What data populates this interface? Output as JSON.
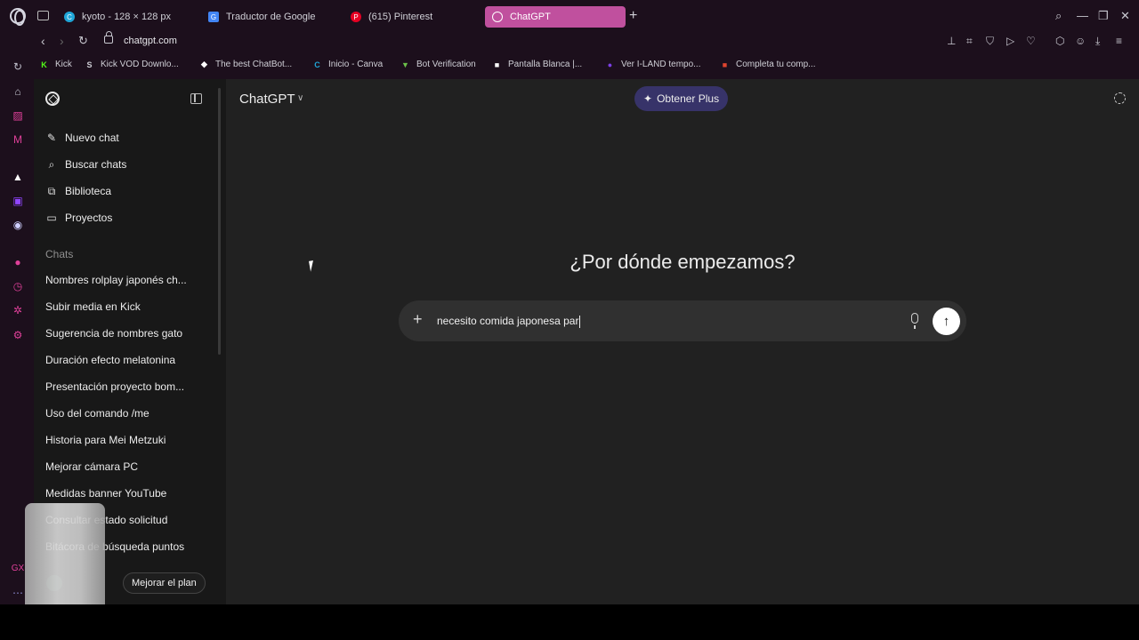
{
  "browser": {
    "tabs": [
      {
        "label": "kyoto - 128 × 128 px",
        "icon": "canva-icon",
        "color": "#1fa6d8"
      },
      {
        "label": "Traductor de Google",
        "icon": "google-translate-icon",
        "color": "#4285f4"
      },
      {
        "label": "(615) Pinterest",
        "icon": "pinterest-icon",
        "color": "#e60023"
      },
      {
        "label": "ChatGPT",
        "icon": "chatgpt-icon",
        "color": "#c0509e"
      }
    ],
    "url": "chatgpt.com",
    "bookmarks": [
      {
        "label": "Kick",
        "icon": "kick-icon",
        "color": "#53fc18",
        "glyph": "K"
      },
      {
        "label": "Kick VOD Downlo...",
        "icon": "kick-vod-icon",
        "color": "#cfcfd6",
        "glyph": "S"
      },
      {
        "label": "The best ChatBot...",
        "icon": "chatbot-icon",
        "color": "#ffffff",
        "glyph": "◆"
      },
      {
        "label": "Inicio - Canva",
        "icon": "canva-icon",
        "color": "#1fa6d8",
        "glyph": "C"
      },
      {
        "label": "Bot Verification",
        "icon": "bot-icon",
        "color": "#6cc04a",
        "glyph": "▼"
      },
      {
        "label": "Pantalla Blanca |...",
        "icon": "white-screen-icon",
        "color": "#ffffff",
        "glyph": "■"
      },
      {
        "label": "Ver I-LAND tempo...",
        "icon": "iland-icon",
        "color": "#7b3fe4",
        "glyph": "●"
      },
      {
        "label": "Completa tu comp...",
        "icon": "form-icon",
        "color": "#e0442f",
        "glyph": "■"
      }
    ]
  },
  "app": {
    "model": "ChatGPT",
    "upgrade_label": "Obtener Plus",
    "menu": [
      {
        "label": "Nuevo chat",
        "icon": "edit-icon"
      },
      {
        "label": "Buscar chats",
        "icon": "search-icon"
      },
      {
        "label": "Biblioteca",
        "icon": "library-icon"
      },
      {
        "label": "Proyectos",
        "icon": "folder-plus-icon"
      }
    ],
    "chats_label": "Chats",
    "chats": [
      "Nombres rolplay japonés ch...",
      "Subir media en Kick",
      "Sugerencia de nombres gato",
      "Duración efecto melatonina",
      "Presentación proyecto bom...",
      "Uso del comando /me",
      "Historia para Mei Metzuki",
      "Mejorar cámara PC",
      "Medidas banner YouTube",
      "Consultar estado solicitud",
      "Bitácora de búsqueda puntos"
    ],
    "improve_plan": "Mejorar el plan",
    "headline": "¿Por dónde empezamos?",
    "composer_value": "necesito comida japonesa par"
  },
  "colors": {
    "sidebar_bg": "#181818",
    "main_bg": "#212121",
    "plus_button": "#373369",
    "active_tab": "#c0509e"
  }
}
